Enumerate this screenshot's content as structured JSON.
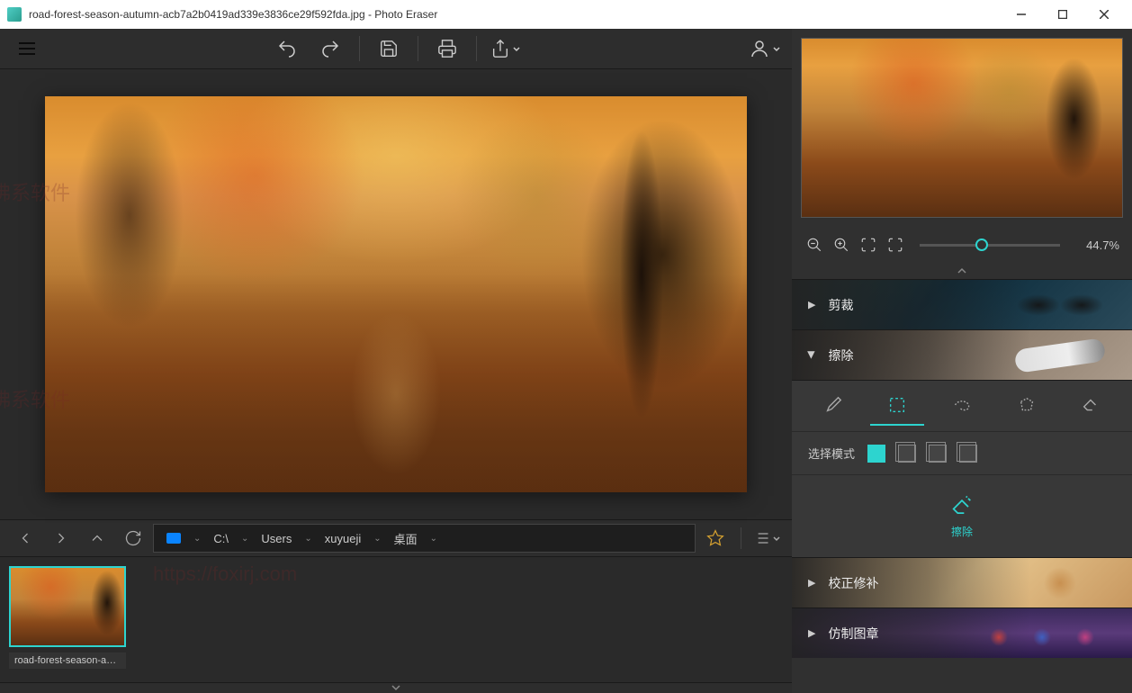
{
  "titlebar": {
    "filename": "road-forest-season-autumn-acb7a2b0419ad339e3836ce29f592fda.jpg",
    "separator": " - ",
    "appname": "Photo Eraser"
  },
  "toolbar": {
    "menu": "menu",
    "undo": "undo",
    "redo": "redo",
    "save": "save",
    "print": "print",
    "share": "share",
    "account": "account"
  },
  "browser": {
    "back": "back",
    "forward": "forward",
    "up": "up",
    "refresh": "refresh",
    "path": [
      "C:\\",
      "Users",
      "xuyueji",
      "桌面"
    ],
    "star": "favorite",
    "view": "view-options"
  },
  "thumbs": {
    "items": [
      {
        "label": "road-forest-season-autu..."
      }
    ]
  },
  "zoom": {
    "out": "zoom-out",
    "in": "zoom-in",
    "fit": "fit-screen",
    "actual": "actual-size",
    "value": "44.7%"
  },
  "sections": {
    "crop": "剪裁",
    "erase": "擦除",
    "heal": "校正修补",
    "clone": "仿制图章"
  },
  "eraseTools": {
    "brush": "brush",
    "marquee": "marquee",
    "lasso": "lasso",
    "polygon": "polygon",
    "eraser": "eraser"
  },
  "modeRow": {
    "label": "选择模式"
  },
  "action": {
    "label": "擦除"
  },
  "watermarks": {
    "text1": "佛系软件",
    "text2": "https://foxirj.com"
  }
}
